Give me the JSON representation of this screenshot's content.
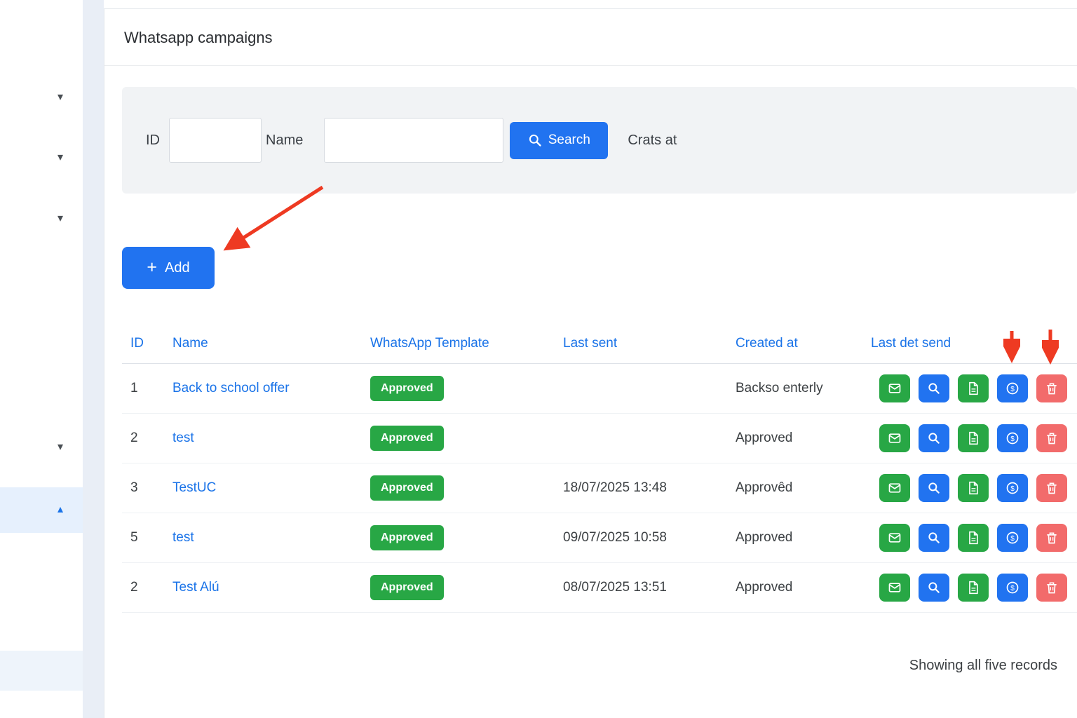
{
  "colors": {
    "primary_blue": "#2173f0",
    "link_blue": "#1a73e8",
    "success_green": "#28a745",
    "danger_red": "#f26b6b",
    "annotation_red": "#ee3a22",
    "panel_gray": "#f1f3f5"
  },
  "icons": {
    "chevron_down": "▾",
    "chevron_up": "▴",
    "plus": "+"
  },
  "page": {
    "title": "Whatsapp campaigns"
  },
  "filters": {
    "id_label": "ID",
    "id_value": "",
    "name_label": "Name",
    "name_value": "",
    "search_button": "Search",
    "created_label": "Crats at"
  },
  "toolbar": {
    "add_button": "Add"
  },
  "table": {
    "headers": [
      "ID",
      "Name",
      "WhatsApp Template",
      "Last sent",
      "Created at",
      "Last det send"
    ],
    "rows": [
      {
        "id": "1",
        "name": "Back to school offer",
        "template_status": "Approved",
        "last_sent": "",
        "created_at": "Backso enterly"
      },
      {
        "id": "2",
        "name": "test",
        "template_status": "Approved",
        "last_sent": "",
        "created_at": "Approved"
      },
      {
        "id": "3",
        "name": "TestUC",
        "template_status": "Approved",
        "last_sent": "18/07/2025 13:48",
        "created_at": "Approvêd"
      },
      {
        "id": "5",
        "name": "test",
        "template_status": "Approved",
        "last_sent": "09/07/2025 10:58",
        "created_at": "Approved"
      },
      {
        "id": "2",
        "name": "Test Alú",
        "template_status": "Approved",
        "last_sent": "08/07/2025 13:51",
        "created_at": "Approved"
      }
    ]
  },
  "footer": {
    "summary": "Showing all five records"
  }
}
